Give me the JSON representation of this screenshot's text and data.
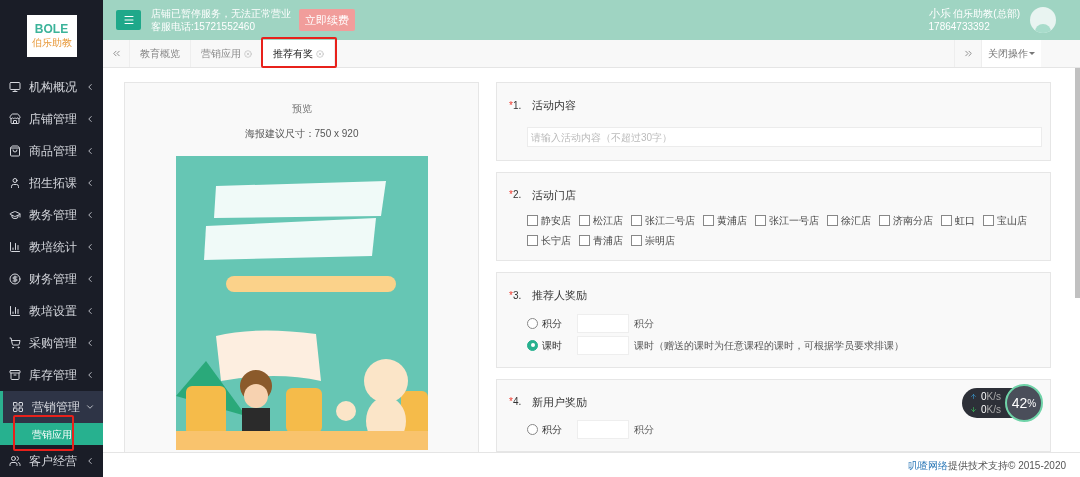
{
  "logo": {
    "title": "BOLE",
    "subtitle": "伯乐助教"
  },
  "sidebar": {
    "items": [
      {
        "label": "机构概况",
        "expanded": false
      },
      {
        "label": "店铺管理",
        "expanded": false
      },
      {
        "label": "商品管理",
        "expanded": false
      },
      {
        "label": "招生拓课",
        "expanded": false
      },
      {
        "label": "教务管理",
        "expanded": false
      },
      {
        "label": "教培统计",
        "expanded": false
      },
      {
        "label": "财务管理",
        "expanded": false
      },
      {
        "label": "教培设置",
        "expanded": false
      },
      {
        "label": "采购管理",
        "expanded": false
      },
      {
        "label": "库存管理",
        "expanded": false
      },
      {
        "label": "营销管理",
        "expanded": true,
        "children": [
          {
            "label": "营销应用",
            "selected": true
          }
        ]
      },
      {
        "label": "客户经营",
        "expanded": false
      }
    ]
  },
  "topbar": {
    "notice": "店铺已暂停服务，无法正常营业",
    "phone": "客服电话:15721552460",
    "renew_button": "立即续费",
    "user_name": "小乐",
    "user_role": "伯乐助教(总部)",
    "user_phone": "17864733392"
  },
  "tabs": [
    {
      "label": "教育概览",
      "closable": false,
      "selected": false
    },
    {
      "label": "营销应用",
      "closable": true,
      "selected": false
    },
    {
      "label": "推荐有奖",
      "closable": true,
      "selected": true
    }
  ],
  "close_menu": "关闭操作",
  "preview": {
    "title": "预览",
    "hint": "海报建议尺寸：750 x 920"
  },
  "sections": [
    {
      "kind": "text",
      "required_mark": "*",
      "number": "1.",
      "title": "活动内容",
      "placeholder": "请输入活动内容（不超过30字）"
    },
    {
      "kind": "checkboxes",
      "required_mark": "*",
      "number": "2.",
      "title": "活动门店",
      "options": [
        {
          "label": "静安店",
          "checked": false
        },
        {
          "label": "松江店",
          "checked": false
        },
        {
          "label": "张江二号店",
          "checked": false
        },
        {
          "label": "黄浦店",
          "checked": false
        },
        {
          "label": "张江一号店",
          "checked": false
        },
        {
          "label": "徐汇店",
          "checked": false
        },
        {
          "label": "济南分店",
          "checked": false
        },
        {
          "label": "虹口",
          "checked": false
        },
        {
          "label": "宝山店",
          "checked": false
        },
        {
          "label": "长宁店",
          "checked": false
        },
        {
          "label": "青浦店",
          "checked": false
        },
        {
          "label": "崇明店",
          "checked": false
        }
      ]
    },
    {
      "kind": "radios",
      "required_mark": "*",
      "number": "3.",
      "title": "推荐人奖励",
      "options": [
        {
          "label": "积分",
          "selected": false,
          "unit": "积分"
        },
        {
          "label": "课时",
          "selected": true,
          "unit": "课时（赠送的课时为任意课程的课时，可根据学员要求排课）"
        }
      ]
    },
    {
      "kind": "radios",
      "required_mark": "*",
      "number": "4.",
      "title": "新用户奖励",
      "options": [
        {
          "label": "积分",
          "selected": false,
          "unit": "积分"
        }
      ]
    }
  ],
  "footer": {
    "link": "叽喳网络",
    "text": "提供技术支持© 2015-2020"
  },
  "net_meter": {
    "up": "0",
    "up_unit": "K/s",
    "down": "0",
    "down_unit": "K/s",
    "percent": "42",
    "percent_sign": "%"
  }
}
